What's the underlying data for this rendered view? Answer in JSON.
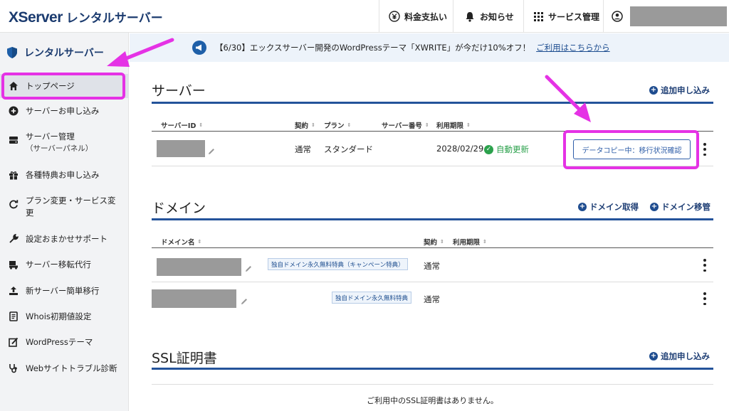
{
  "header": {
    "logo_main": "XServer",
    "logo_sub": "レンタルサーバー",
    "nav": [
      {
        "label": "料金支払い",
        "icon": "yen-icon"
      },
      {
        "label": "お知らせ",
        "icon": "bell-icon"
      },
      {
        "label": "サービス管理",
        "icon": "grid-icon"
      },
      {
        "label": "",
        "icon": "user-icon"
      }
    ]
  },
  "sidebar": {
    "title": "レンタルサーバー",
    "items": [
      {
        "label": "トップページ",
        "icon": "home-icon",
        "active": true
      },
      {
        "label": "サーバーお申し込み",
        "icon": "plus-circle-icon"
      },
      {
        "label": "サーバー管理",
        "sublabel": "（サーバーパネル）",
        "icon": "server-icon"
      },
      {
        "label": "各種特典お申し込み",
        "icon": "gift-icon"
      },
      {
        "label": "プラン変更・サービス変更",
        "icon": "refresh-icon"
      },
      {
        "label": "設定おまかせサポート",
        "icon": "wrench-icon"
      },
      {
        "label": "サーバー移転代行",
        "icon": "truck-icon"
      },
      {
        "label": "新サーバー簡単移行",
        "icon": "upload-icon"
      },
      {
        "label": "Whois初期値設定",
        "icon": "document-icon"
      },
      {
        "label": "WordPressテーマ",
        "icon": "edit-icon"
      },
      {
        "label": "Webサイトトラブル診断",
        "icon": "stethoscope-icon"
      }
    ]
  },
  "banner": {
    "text": "【6/30】エックスサーバー開発のWordPressテーマ「XWRITE」が今だけ10%オフ！",
    "link": "ご利用はこちらから"
  },
  "server": {
    "title": "サーバー",
    "add_label": "追加申し込み",
    "columns": [
      "サーバーID",
      "契約",
      "プラン",
      "サーバー番号",
      "利用期限"
    ],
    "rows": [
      {
        "contract": "通常",
        "plan": "スタンダード",
        "number": "",
        "expiry": "2028/02/29",
        "status": "自動更新",
        "action": "データコピー中：移行状況確認"
      }
    ]
  },
  "domain": {
    "title": "ドメイン",
    "acquire_label": "ドメイン取得",
    "transfer_label": "ドメイン移管",
    "columns": [
      "ドメイン名",
      "契約",
      "利用期限"
    ],
    "rows": [
      {
        "badge": "独自ドメイン永久無料特典（キャンペーン特典）",
        "contract": "通常",
        "expiry": ""
      },
      {
        "badge": "独自ドメイン永久無料特典",
        "contract": "通常",
        "expiry": ""
      }
    ]
  },
  "ssl": {
    "title": "SSL証明書",
    "add_label": "追加申し込み",
    "empty_message": "ご利用中のSSL証明書はありません。"
  },
  "colors": {
    "brand_navy": "#1b3b6f",
    "accent_blue": "#24539a",
    "status_green": "#2ba14c",
    "annotation_magenta": "#e532e5"
  }
}
